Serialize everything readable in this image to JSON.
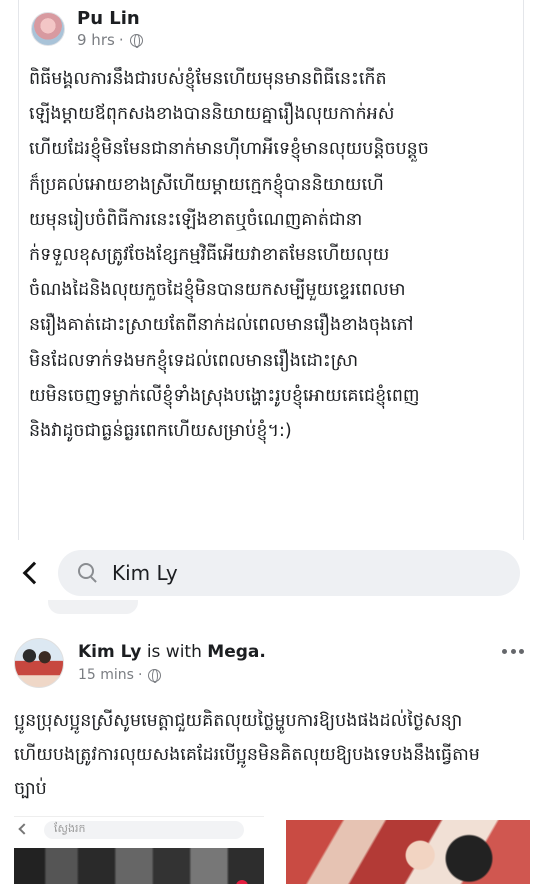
{
  "post1": {
    "author": "Pu Lin",
    "time": "9 hrs",
    "separator": "·",
    "privacy_icon": "globe-icon",
    "lines": [
      "ពិធីមង្គលការនឹងជារបស់ខ្ញុំមែនហើយមុនមានពិធីនេះកើត",
      "ឡើងម្តាយឪពុកសងខាងបាននិយាយគ្នារឿងលុយកាក់អស់",
      "ហើយដែរខ្ញុំមិនមែនជានាក់មានហ៊ីហាអីទេខ្ញុំមានលុយបន្តិចបន្តួច",
      "ក៏ប្រគល់អោយខាងស្រីហើយម្តាយក្មេកខ្ញុំបាននិយាយហើ",
      "យមុនរៀបចំពិធីការនេះឡើងខាតឬចំណេញគាត់ជានា",
      "ក់ទទួលខុសត្រូវចែងខ្សែកម្មវិធីអើយវាខាតមែនហើយលុយ",
      "ចំណងដៃនិងលុយកួចដៃខ្ញុំមិនបានយកសម្បីមួយខ្ទេរពេលមា",
      "នរឿងគាត់ដោះស្រាយតែពីនាក់ដល់ពេលមានរឿងខាងចុងភៅ",
      "មិនដែលទាក់ទងមកខ្ញុំទេដល់ពេលមានរឿងដោះស្រា",
      "យមិនចេញទម្លាក់លើខ្ញុំទាំងស្រុងបង្ហោះរូបខ្ញុំអោយគេជេខ្ញុំពេញ",
      "និងវាដូចជាធ្ងន់ធ្ងរពេកហើយសម្រាប់ខ្ញុំ។:)"
    ]
  },
  "search": {
    "back_icon": "chevron-left-icon",
    "search_icon": "search-icon",
    "query": "Kim Ly"
  },
  "post2": {
    "author": "Kim Ly",
    "with_text": "is with",
    "tagged": "Mega.",
    "time": "15 mins",
    "separator": "·",
    "privacy_icon": "globe-icon",
    "more_icon": "more-horizontal-icon",
    "lines": [
      "ប្អូនប្រុសប្អូនស្រីសូមមេត្តាជួយគិតលុយថ្លៃម្ហូបការឱ្យបងផងដល់ថ្ងៃសន្យា",
      "ហើយបងត្រូវការលុយសងគេដែរបើប្អូនមិនគិតលុយឱ្យបងទេបងនឹងធ្វើតាម",
      "ច្បាប់"
    ]
  },
  "preview": {
    "mini_search_placeholder": "ស្វែងរក"
  }
}
